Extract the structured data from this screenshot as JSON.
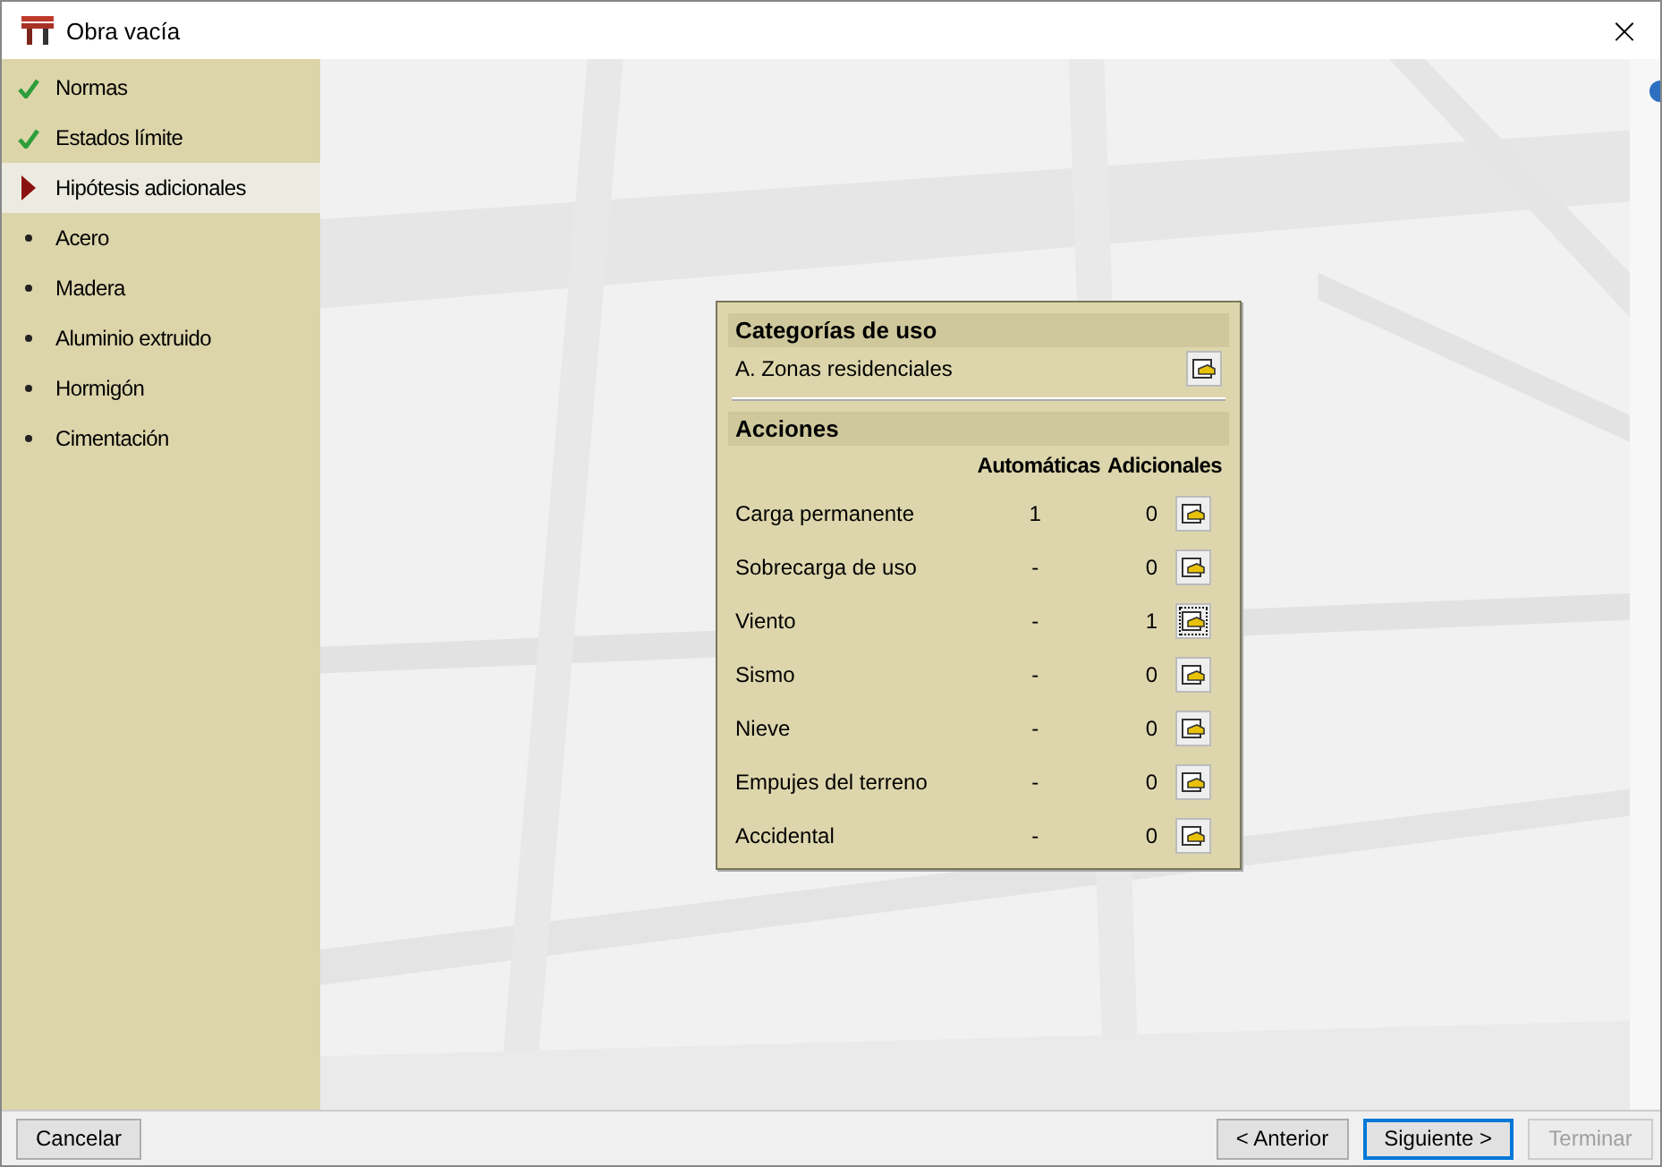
{
  "window": {
    "title": "Obra vacía",
    "close": "×"
  },
  "steps": [
    {
      "label": "Normas",
      "kind": "done"
    },
    {
      "label": "Estados límite",
      "kind": "done"
    },
    {
      "label": "Hipótesis adicionales",
      "kind": "current"
    },
    {
      "label": "Acero",
      "kind": "pending"
    },
    {
      "label": "Madera",
      "kind": "pending"
    },
    {
      "label": "Aluminio extruido",
      "kind": "pending"
    },
    {
      "label": "Hormigón",
      "kind": "pending"
    },
    {
      "label": "Cimentación",
      "kind": "pending"
    }
  ],
  "panel": {
    "category_heading": "Categorías de uso",
    "category_value": "A. Zonas residenciales",
    "actions_heading": "Acciones",
    "columns": [
      "Automáticas",
      "Adicionales"
    ],
    "rows": [
      {
        "name": "Carga permanente",
        "automatic": "1",
        "additional": "0",
        "focused": false
      },
      {
        "name": "Sobrecarga de uso",
        "automatic": "-",
        "additional": "0",
        "focused": false
      },
      {
        "name": "Viento",
        "automatic": "-",
        "additional": "1",
        "focused": true
      },
      {
        "name": "Sismo",
        "automatic": "-",
        "additional": "0",
        "focused": false
      },
      {
        "name": "Nieve",
        "automatic": "-",
        "additional": "0",
        "focused": false
      },
      {
        "name": "Empujes del terreno",
        "automatic": "-",
        "additional": "0",
        "focused": false
      },
      {
        "name": "Accidental",
        "automatic": "-",
        "additional": "0",
        "focused": false
      }
    ]
  },
  "cancel_button": {
    "label": "Cancelar"
  },
  "nav_buttons": [
    {
      "label": "< Anterior",
      "default": false,
      "disabled": false
    },
    {
      "label": "Siguiente >",
      "default": true,
      "disabled": false
    },
    {
      "label": "Terminar",
      "default": false,
      "disabled": true
    }
  ]
}
